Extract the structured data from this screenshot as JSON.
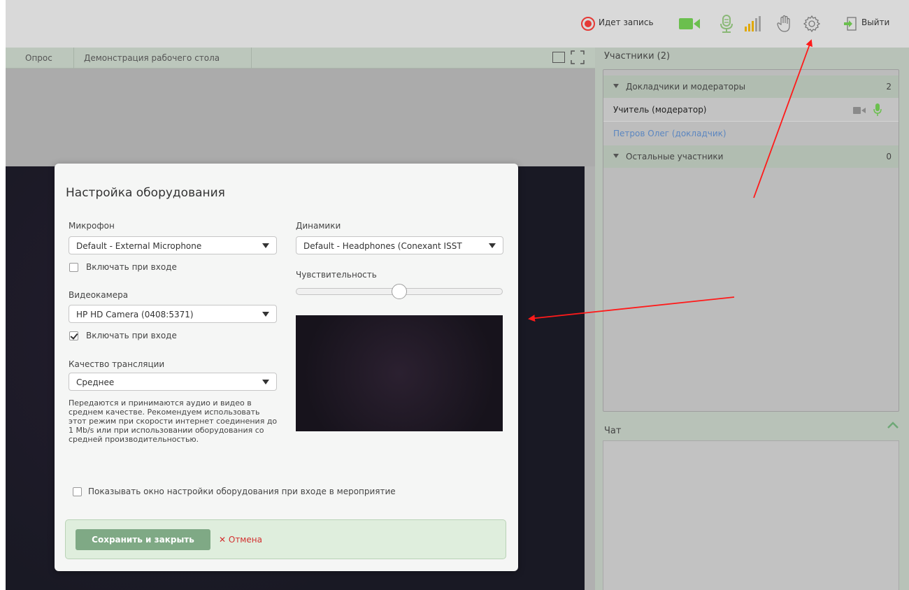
{
  "topbar": {
    "recording_label": "Идет запись",
    "exit_label": "Выйти",
    "icons": [
      "record-icon",
      "camera-icon",
      "microphone-icon",
      "signal-icon",
      "hand-icon",
      "gear-icon",
      "exit-icon"
    ],
    "accent_color": "#e53935",
    "icon_green": "#6bbf4e",
    "icon_yellow": "#e0a800"
  },
  "tabs": [
    {
      "label": "Опрос"
    },
    {
      "label": "Демонстрация рабочего стола"
    }
  ],
  "participants": {
    "title": "Участники (2)",
    "groups": [
      {
        "label": "Докладчики и модераторы",
        "count": "2"
      },
      {
        "label": "Остальные участники",
        "count": "0"
      }
    ],
    "rows": [
      {
        "name": "Учитель (модератор)"
      },
      {
        "name": "Петров Олег (докладчик)"
      }
    ]
  },
  "chat": {
    "title": "Чат"
  },
  "modal": {
    "title": "Настройка оборудования",
    "microphone": {
      "label": "Микрофон",
      "value": "Default - External Microphone",
      "enable_on_join": "Включать при входе",
      "checked": false
    },
    "speakers": {
      "label": "Динамики",
      "value": "Default - Headphones (Conexant ISST"
    },
    "sensitivity": {
      "label": "Чувствительность",
      "value_fraction": 0.5
    },
    "camera": {
      "label": "Видеокамера",
      "value": "HP HD Camera (0408:5371)",
      "enable_on_join": "Включать при входе",
      "checked": true
    },
    "quality": {
      "label": "Качество трансляции",
      "value": "Среднее",
      "description": "Передаются и принимаются аудио и видео в среднем качестве. Рекомендуем использовать этот режим при скорости интернет соединения до 1 Mb/s или при использовании оборудования со средней производительностью."
    },
    "show_on_join": {
      "label": "Показывать окно настройки оборудования при входе в мероприятие",
      "checked": false
    },
    "save_label": "Сохранить и закрыть",
    "cancel_label": "Отмена",
    "save_color": "#7fa985",
    "cancel_color": "#d32f2f"
  }
}
